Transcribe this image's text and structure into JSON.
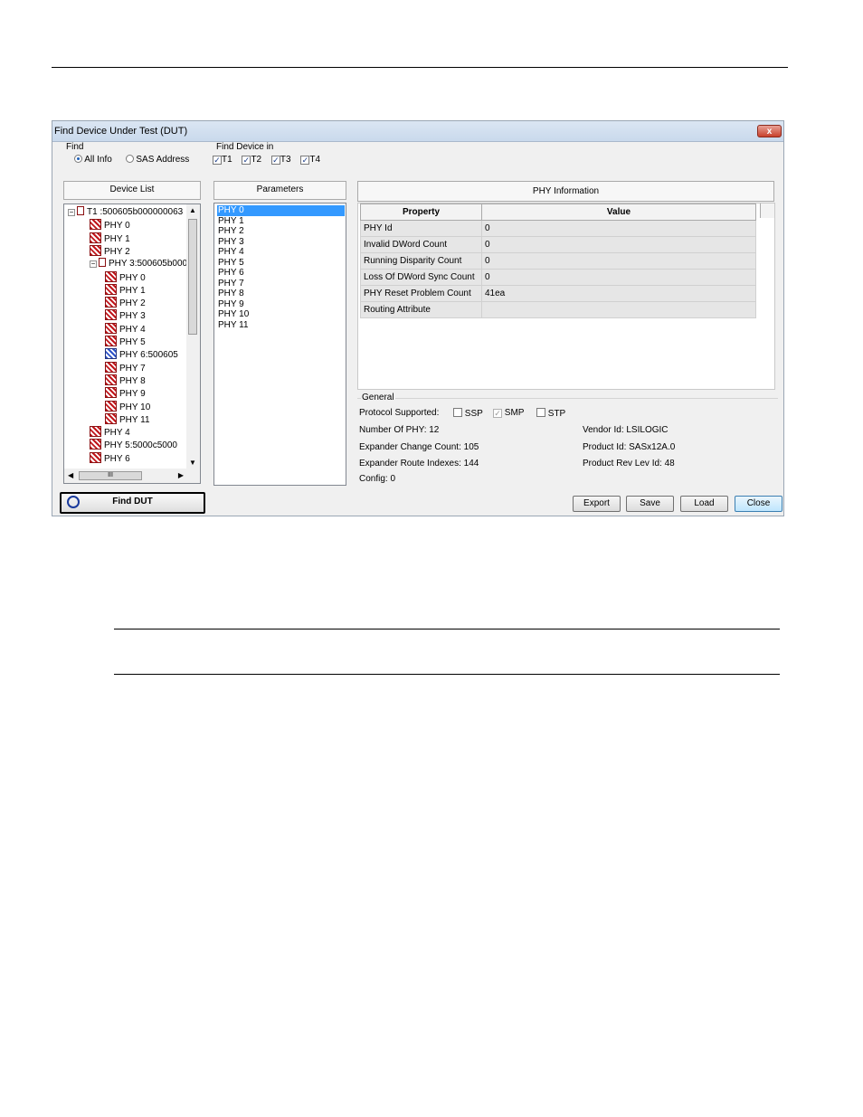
{
  "window": {
    "title": "Find Device Under Test (DUT)",
    "close_label": "x"
  },
  "find": {
    "group_label": "Find",
    "options": [
      {
        "label": "All Info",
        "selected": true
      },
      {
        "label": "SAS Address",
        "selected": false
      }
    ]
  },
  "find_in": {
    "group_label": "Find Device in",
    "options": [
      {
        "label": "T1",
        "checked": true
      },
      {
        "label": "T2",
        "checked": true
      },
      {
        "label": "T3",
        "checked": true
      },
      {
        "label": "T4",
        "checked": true
      }
    ]
  },
  "device_list": {
    "header": "Device List",
    "items": [
      {
        "label": "T1 :500605b000000063",
        "level": 0,
        "kind": "device",
        "expander": "−"
      },
      {
        "label": "PHY 0",
        "level": 1,
        "kind": "phy"
      },
      {
        "label": "PHY 1",
        "level": 1,
        "kind": "phy"
      },
      {
        "label": "PHY 2",
        "level": 1,
        "kind": "phy"
      },
      {
        "label": "PHY 3:500605b000",
        "level": 1,
        "kind": "device",
        "expander": "−"
      },
      {
        "label": "PHY 0",
        "level": 2,
        "kind": "phy"
      },
      {
        "label": "PHY 1",
        "level": 2,
        "kind": "phy"
      },
      {
        "label": "PHY 2",
        "level": 2,
        "kind": "phy"
      },
      {
        "label": "PHY 3",
        "level": 2,
        "kind": "phy"
      },
      {
        "label": "PHY 4",
        "level": 2,
        "kind": "phy"
      },
      {
        "label": "PHY 5",
        "level": 2,
        "kind": "phy"
      },
      {
        "label": "PHY 6:500605",
        "level": 2,
        "kind": "phy-link"
      },
      {
        "label": "PHY 7",
        "level": 2,
        "kind": "phy"
      },
      {
        "label": "PHY 8",
        "level": 2,
        "kind": "phy"
      },
      {
        "label": "PHY 9",
        "level": 2,
        "kind": "phy"
      },
      {
        "label": "PHY 10",
        "level": 2,
        "kind": "phy"
      },
      {
        "label": "PHY 11",
        "level": 2,
        "kind": "phy"
      },
      {
        "label": "PHY 4",
        "level": 1,
        "kind": "phy"
      },
      {
        "label": "PHY 5:5000c5000",
        "level": 1,
        "kind": "phy"
      },
      {
        "label": "PHY 6",
        "level": 1,
        "kind": "phy"
      }
    ],
    "hscroll_grip": "III"
  },
  "parameters": {
    "header": "Parameters",
    "items": [
      "PHY 0",
      "PHY 1",
      "PHY 2",
      "PHY 3",
      "PHY 4",
      "PHY 5",
      "PHY 6",
      "PHY 7",
      "PHY 8",
      "PHY 9",
      "PHY 10",
      "PHY 11"
    ],
    "selected_index": 0
  },
  "phy_info": {
    "header": "PHY Information",
    "columns": [
      "Property",
      "Value"
    ],
    "rows": [
      [
        "PHY Id",
        "0"
      ],
      [
        "Invalid DWord Count",
        "0"
      ],
      [
        "Running Disparity Count",
        "0"
      ],
      [
        "Loss Of DWord Sync Count",
        "0"
      ],
      [
        "PHY Reset Problem Count",
        "41ea"
      ],
      [
        "Routing Attribute",
        ""
      ]
    ]
  },
  "general": {
    "group_label": "General",
    "protocol_label": "Protocol Supported:",
    "protocols": [
      {
        "label": "SSP",
        "checked": false,
        "disabled": false
      },
      {
        "label": "SMP",
        "checked": true,
        "disabled": true
      },
      {
        "label": "STP",
        "checked": false,
        "disabled": false
      }
    ],
    "left": [
      "Number Of PHY: 12",
      "Expander Change Count: 105",
      "Expander Route Indexes: 144",
      "Config: 0"
    ],
    "right": [
      "Vendor Id: LSILOGIC",
      "Product Id: SASx12A.0",
      "Product Rev Lev Id: 48"
    ]
  },
  "buttons": {
    "find_dut": "Find DUT",
    "export": "Export",
    "save": "Save",
    "load": "Load",
    "close": "Close"
  }
}
